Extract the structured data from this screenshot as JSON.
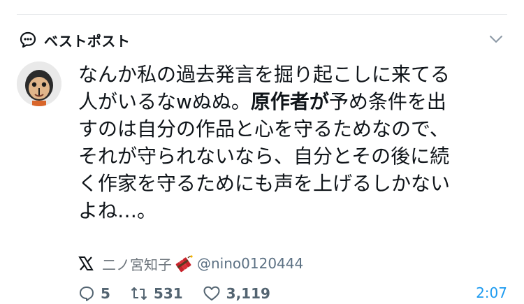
{
  "header": {
    "title": "ベストポスト",
    "icon": "speech-bubble-icon",
    "collapse_icon": "chevron-down-icon"
  },
  "post": {
    "text_segments": [
      "なんか私の過去発言を掘り起こしに来てる\n人がいるなwぬぬ。",
      "原作者が",
      "予め条件を出\nすのは自分の作品と心を守るためなので、\nそれが守られないなら、自分とその後に続\nく作家を守るためにも声を上げるしかない\nよね…。"
    ],
    "source": {
      "platform_icon": "x-logo-icon",
      "author_name": "二ノ宮知子",
      "emoji_icon": "dynamite-icon",
      "handle": "@nino0120444"
    },
    "stats": {
      "replies": "5",
      "reposts": "531",
      "likes": "3,119",
      "time": "2:07"
    }
  },
  "colors": {
    "text": "#0f1419",
    "muted": "#536471",
    "accent": "#1d9bf0"
  }
}
